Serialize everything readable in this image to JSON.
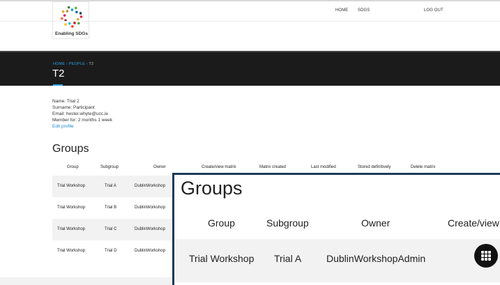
{
  "logo": {
    "text": "Enabling SDGs",
    "wheel_colors": [
      "#e5243b",
      "#dda63a",
      "#4c9f38",
      "#c5192d",
      "#ff3a21",
      "#26bde2",
      "#fcc30b",
      "#a21942",
      "#fd6925",
      "#dd1367",
      "#fd9d24",
      "#bf8b2e",
      "#3f7e44",
      "#0a97d9",
      "#56c02b",
      "#00689d",
      "#19486a"
    ]
  },
  "nav": {
    "home": "HOME",
    "sdgs": "SDGS",
    "logout": "LOG OUT"
  },
  "breadcrumb": {
    "home": "HOME",
    "sep1": " › ",
    "people": "PEOPLE",
    "sep2": " › ",
    "current": "T2"
  },
  "page_title": "T2",
  "profile": {
    "name": "Name: Trial 2",
    "surname": "Surname: Participant",
    "email": "Email: hester.whyte@ucc.ie",
    "member_for": "Member for: 2 months 1 week",
    "edit": "Edit profile"
  },
  "groups": {
    "title": "Groups",
    "headers": [
      "Group",
      "Subgroup",
      "Owner",
      "Create/view matrix",
      "Matrix created",
      "Last modified",
      "Stored definitively",
      "Delete matrix"
    ],
    "rows": [
      [
        "Trial Workshop",
        "Trial A",
        "DublinWorkshop"
      ],
      [
        "Trial Workshop",
        "Trial B",
        "DublinWorkshop"
      ],
      [
        "Trial Workshop",
        "Trial C",
        "DublinWorkshop"
      ],
      [
        "Trial Workshop",
        "Trial D",
        "DublinWorkshop"
      ]
    ]
  },
  "zoom": {
    "title": "Groups",
    "headers": [
      "Group",
      "Subgroup",
      "Owner",
      "Create/view r"
    ],
    "row": [
      "Trial Workshop",
      "Trial A",
      "DublinWorkshopAdmin"
    ]
  },
  "fab": {
    "icon": "grid-menu-icon"
  }
}
